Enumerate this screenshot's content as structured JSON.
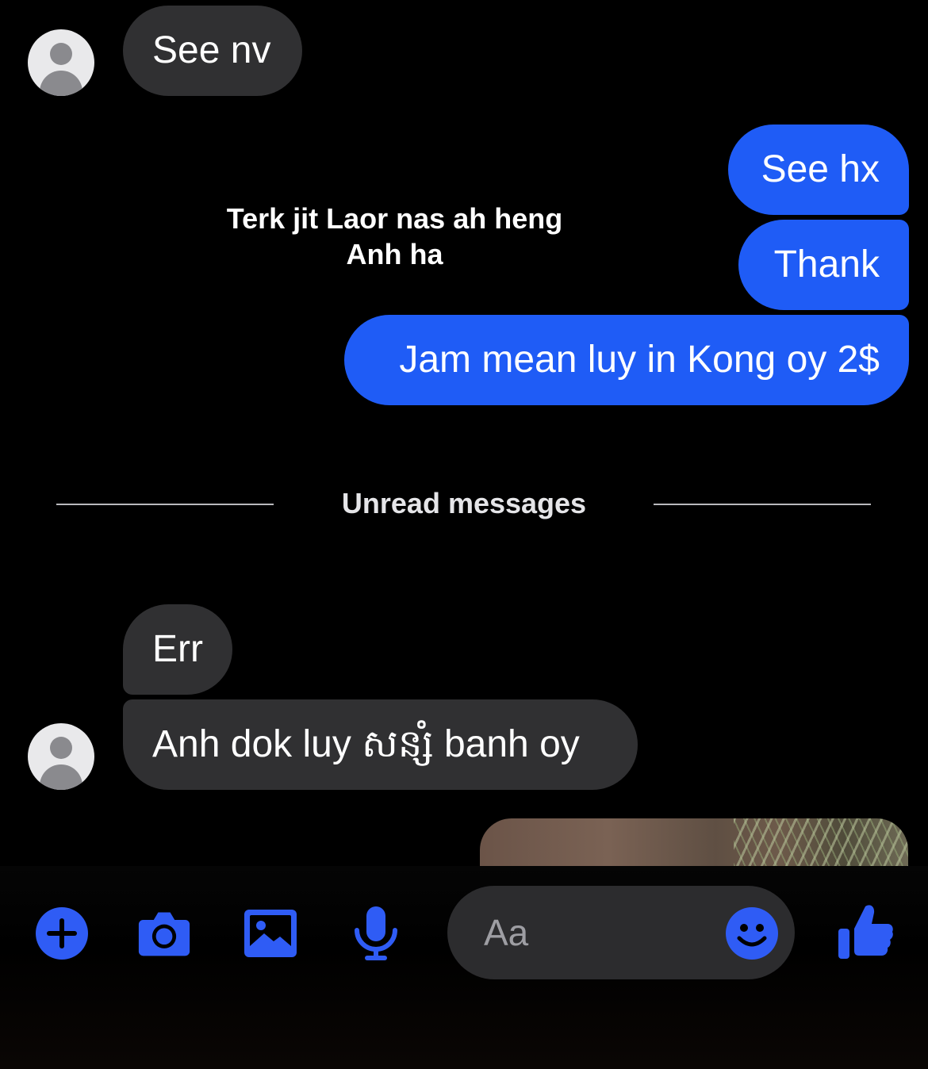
{
  "overlay_caption": {
    "line1": "Terk jit Laor nas ah heng",
    "line2": "Anh ha"
  },
  "messages": {
    "m1": "See nv",
    "m2": "See hx",
    "m3": "Thank",
    "m4": "Jam mean luy in Kong oy 2$",
    "m5": "Err",
    "m6": "Anh dok luy សន្សំ banh oy"
  },
  "divider": {
    "label": "Unread messages"
  },
  "composer": {
    "placeholder": "Aa"
  },
  "toolbar": {
    "icons": [
      "plus-icon",
      "camera-icon",
      "gallery-icon",
      "microphone-icon",
      "emoji-icon",
      "thumbs-up-icon"
    ]
  },
  "colors": {
    "outgoing_bubble": "#1f5cf6",
    "incoming_bubble": "#303032",
    "icon_blue": "#2f5cf5",
    "background": "#000000"
  }
}
